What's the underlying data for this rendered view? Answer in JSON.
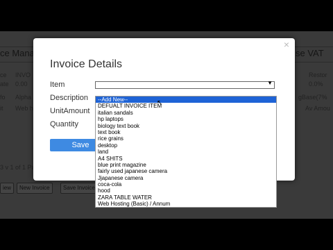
{
  "background": {
    "left_title": "ce Mana",
    "right_title": "se VAT",
    "left_rows": [
      "INVO",
      "0.00",
      "Alpha",
      "Web h"
    ],
    "left_row_labels": [
      "ce",
      "ate",
      "fo",
      "it"
    ],
    "right_rows": [
      "Restor",
      "0.0%",
      "gBase(7%",
      "Av Amou"
    ],
    "bottom_left": "3 v 1 of 1 Pa",
    "buttons": [
      "iew",
      "New Invoice",
      "Save Invoice"
    ]
  },
  "modal": {
    "title": "Invoice Details",
    "close_symbol": "×",
    "labels": {
      "item": "Item",
      "description": "Description",
      "unit_amount": "UnitAmount",
      "quantity": "Quantity"
    },
    "select_value": "",
    "select_arrow": "▼",
    "save_label": "Save"
  },
  "dropdown": {
    "options": [
      "--Add New--",
      "DEFUALT INVOICE ITEM",
      "italian sandals",
      "hp laptops",
      "biology text book",
      "text book",
      "rice grains",
      "desktop",
      "land",
      "A4 SHITS",
      "blue print magazine",
      "fairly used japanese camera",
      "Jjapanese camera",
      "coca-cola",
      "hood",
      "ZARA TABLE WATER",
      "Web Hosting (Basic) / Annum"
    ],
    "selected_index": 0
  },
  "colors": {
    "accent": "#3e8ae2",
    "highlight": "#1e63d6"
  }
}
